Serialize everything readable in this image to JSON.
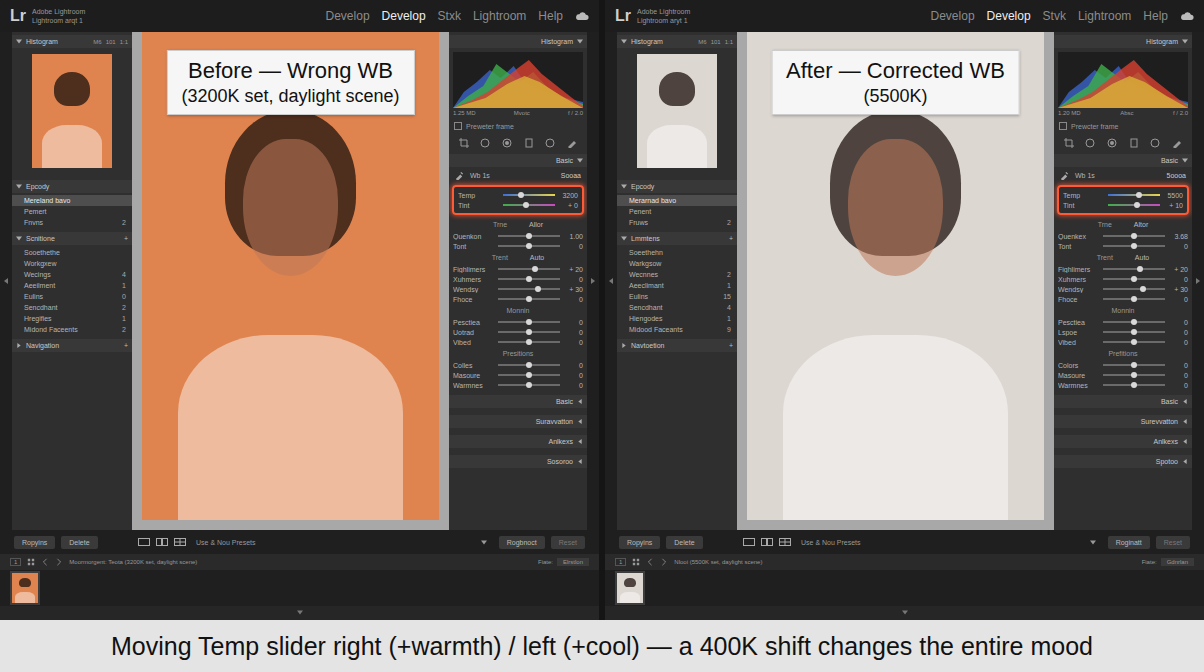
{
  "caption": "Moving Temp slider right (+warmth) / left (+cool) — a 400K shift changes the entire mood",
  "panels": [
    {
      "logo": "Lr",
      "app_name": "Adobe Lightroom",
      "catalog": "Lightroom arqt 1",
      "modules": [
        {
          "label": "Develop",
          "selected": false
        },
        {
          "label": "Develop",
          "selected": true
        },
        {
          "label": "Stxk",
          "selected": false
        },
        {
          "label": "Lightroom",
          "selected": false
        },
        {
          "label": "Help",
          "selected": false
        }
      ],
      "left_sidebar": {
        "histogram_title": "Histogram",
        "histogram_options": [
          "M6",
          "101",
          "1:1"
        ],
        "sections": [
          {
            "title": "Epcody",
            "expanded": true,
            "action": "",
            "items": [
              {
                "label": "Mereland bavo",
                "count": "",
                "selected": true
              },
              {
                "label": "Pemert",
                "count": "",
                "selected": false
              },
              {
                "label": "Fnvns",
                "count": "2",
                "selected": false
              }
            ]
          },
          {
            "title": "Scnitione",
            "expanded": true,
            "action": "+",
            "items": [
              {
                "label": "Sooethethe",
                "count": "",
                "selected": false
              },
              {
                "label": "Workgxew",
                "count": "",
                "selected": false
              },
              {
                "label": "Wecings",
                "count": "4",
                "selected": false
              },
              {
                "label": "Aeeilment",
                "count": "1",
                "selected": false
              },
              {
                "label": "Eulins",
                "count": "0",
                "selected": false
              },
              {
                "label": "Sencdhant",
                "count": "2",
                "selected": false
              },
              {
                "label": "Hregifies",
                "count": "1",
                "selected": false
              },
              {
                "label": "Midond Faceents",
                "count": "2",
                "selected": false
              }
            ]
          },
          {
            "title": "Navigation",
            "expanded": false,
            "action": "+",
            "items": []
          }
        ]
      },
      "photo": {
        "color": "#e0844f",
        "tag_title": "Before — Wrong WB",
        "tag_subtitle": "(3200K set, daylight scene)"
      },
      "right_panel": {
        "histogram_title": "Histogram",
        "histogram_caption": [
          "1.25 MD",
          "Mvotc",
          "f / 2.0"
        ],
        "preview": {
          "label": "Preweter frame",
          "checked": false
        },
        "basic_title": "Basic",
        "wb": {
          "label": "Wb 1s",
          "value": "Sooaa"
        },
        "wb_highlighted": true,
        "wb_sliders": [
          {
            "label": "Temp",
            "value": "3200",
            "level": 0.35
          },
          {
            "label": "Tint",
            "value": "+ 0",
            "level": 0.45
          }
        ],
        "groups": [
          {
            "title": "Trne",
            "action": "Allor",
            "sliders": [
              {
                "label": "Quenkon",
                "value": "1.00",
                "level": 0.5
              },
              {
                "label": "Tont",
                "value": "0",
                "level": 0.5
              }
            ]
          },
          {
            "title": "Trent",
            "action": "Auto",
            "sliders": [
              {
                "label": "Fighlimers",
                "value": "+ 20",
                "level": 0.6
              },
              {
                "label": "Xuhmers",
                "value": "0",
                "level": 0.5
              },
              {
                "label": "Wendsy",
                "value": "+ 30",
                "level": 0.65
              },
              {
                "label": "Fhoce",
                "value": "0",
                "level": 0.5
              }
            ]
          },
          {
            "title": "Monnin",
            "action": "",
            "sliders": [
              {
                "label": "Pesctiea",
                "value": "0",
                "level": 0.5
              },
              {
                "label": "Uotrad",
                "value": "0",
                "level": 0.5
              },
              {
                "label": "Vibed",
                "value": "0",
                "level": 0.5
              }
            ]
          },
          {
            "title": "Presitions",
            "action": "",
            "sliders": [
              {
                "label": "Colles",
                "value": "0",
                "level": 0.5
              },
              {
                "label": "Masoure",
                "value": "0",
                "level": 0.5
              },
              {
                "label": "Warmnes",
                "value": "0",
                "level": 0.5
              }
            ]
          }
        ],
        "collapsed": [
          "Basic",
          "Suravvatton",
          "Anlkexs",
          "Sosoroo"
        ]
      },
      "toolbar": {
        "left_buttons": [
          "Ropyins",
          "Delete"
        ],
        "preset": "Use & Nou Presets",
        "right_buttons": [
          {
            "label": "Rogbnoct",
            "disabled": false
          },
          {
            "label": "Reset",
            "disabled": true
          }
        ]
      },
      "filmstrip": {
        "page": "1",
        "source": "Moormorgent: Teota (3200K set, daylight scene)",
        "filter_label": "Fiate:",
        "filter_value": "Elrstlon"
      }
    },
    {
      "logo": "Lr",
      "app_name": "Adobe Lightroom",
      "catalog": "Lightroom aryt 1",
      "modules": [
        {
          "label": "Develop",
          "selected": false
        },
        {
          "label": "Develop",
          "selected": true
        },
        {
          "label": "Stvk",
          "selected": false
        },
        {
          "label": "Lightroom",
          "selected": false
        },
        {
          "label": "Help",
          "selected": false
        }
      ],
      "left_sidebar": {
        "histogram_title": "Histogram",
        "histogram_options": [
          "M6",
          "101",
          "1:1"
        ],
        "sections": [
          {
            "title": "Epcody",
            "expanded": true,
            "action": "",
            "items": [
              {
                "label": "Merarnad bavo",
                "count": "",
                "selected": true
              },
              {
                "label": "Penent",
                "count": "",
                "selected": false
              },
              {
                "label": "Fruws",
                "count": "2",
                "selected": false
              }
            ]
          },
          {
            "title": "Lmmtens",
            "expanded": true,
            "action": "+",
            "items": [
              {
                "label": "Soeethehn",
                "count": "",
                "selected": false
              },
              {
                "label": "Warkgsow",
                "count": "",
                "selected": false
              },
              {
                "label": "Wecnnes",
                "count": "2",
                "selected": false
              },
              {
                "label": "Aeeclimant",
                "count": "1",
                "selected": false
              },
              {
                "label": "Eulins",
                "count": "15",
                "selected": false
              },
              {
                "label": "Sencdhant",
                "count": "4",
                "selected": false
              },
              {
                "label": "Hiengodes",
                "count": "1",
                "selected": false
              },
              {
                "label": "Midood Faceants",
                "count": "9",
                "selected": false
              }
            ]
          },
          {
            "title": "Navtoetion",
            "expanded": false,
            "action": "+",
            "items": []
          }
        ]
      },
      "photo": {
        "color": "#ddd7d1",
        "tag_title": "After — Corrected WB",
        "tag_subtitle": "(5500K)"
      },
      "right_panel": {
        "histogram_title": "Histogram",
        "histogram_caption": [
          "1.20 MD",
          "Absc",
          "f / 2.0"
        ],
        "preview": {
          "label": "Prewcter frame",
          "checked": false
        },
        "basic_title": "Basic",
        "wb": {
          "label": "Wb 1s",
          "value": "5oooa"
        },
        "wb_highlighted": true,
        "wb_sliders": [
          {
            "label": "Temp",
            "value": "5500",
            "level": 0.6
          },
          {
            "label": "Tint",
            "value": "+ 10",
            "level": 0.55
          }
        ],
        "groups": [
          {
            "title": "Trne",
            "action": "Altor",
            "sliders": [
              {
                "label": "Quenkex",
                "value": "3.68",
                "level": 0.5
              },
              {
                "label": "Tont",
                "value": "0",
                "level": 0.5
              }
            ]
          },
          {
            "title": "Trent",
            "action": "Auto",
            "sliders": [
              {
                "label": "Fighlimers",
                "value": "+ 20",
                "level": 0.6
              },
              {
                "label": "Xuhmers",
                "value": "0",
                "level": 0.5
              },
              {
                "label": "Wendsy",
                "value": "+ 30",
                "level": 0.65
              },
              {
                "label": "Fhoce",
                "value": "0",
                "level": 0.5
              }
            ]
          },
          {
            "title": "Monnin",
            "action": "",
            "sliders": [
              {
                "label": "Pesctiea",
                "value": "0",
                "level": 0.5
              },
              {
                "label": "Lspoe",
                "value": "0",
                "level": 0.5
              },
              {
                "label": "Vibed",
                "value": "0",
                "level": 0.5
              }
            ]
          },
          {
            "title": "Prefitions",
            "action": "",
            "sliders": [
              {
                "label": "Colors",
                "value": "0",
                "level": 0.5
              },
              {
                "label": "Masoure",
                "value": "0",
                "level": 0.5
              },
              {
                "label": "Warmnes",
                "value": "0",
                "level": 0.5
              }
            ]
          }
        ],
        "collapsed": [
          "Basic",
          "Surevvatton",
          "Anlkexs",
          "Spotoo"
        ]
      },
      "toolbar": {
        "left_buttons": [
          "Ropyins",
          "Delete"
        ],
        "preset": "Use & Nou Presets",
        "right_buttons": [
          {
            "label": "Roginatt",
            "disabled": false
          },
          {
            "label": "Reset",
            "disabled": true
          }
        ]
      },
      "filmstrip": {
        "page": "1",
        "source": "Nlooi (5500K set, daylight scene)",
        "filter_label": "Fiate:",
        "filter_value": "Gdnrlan"
      }
    }
  ]
}
